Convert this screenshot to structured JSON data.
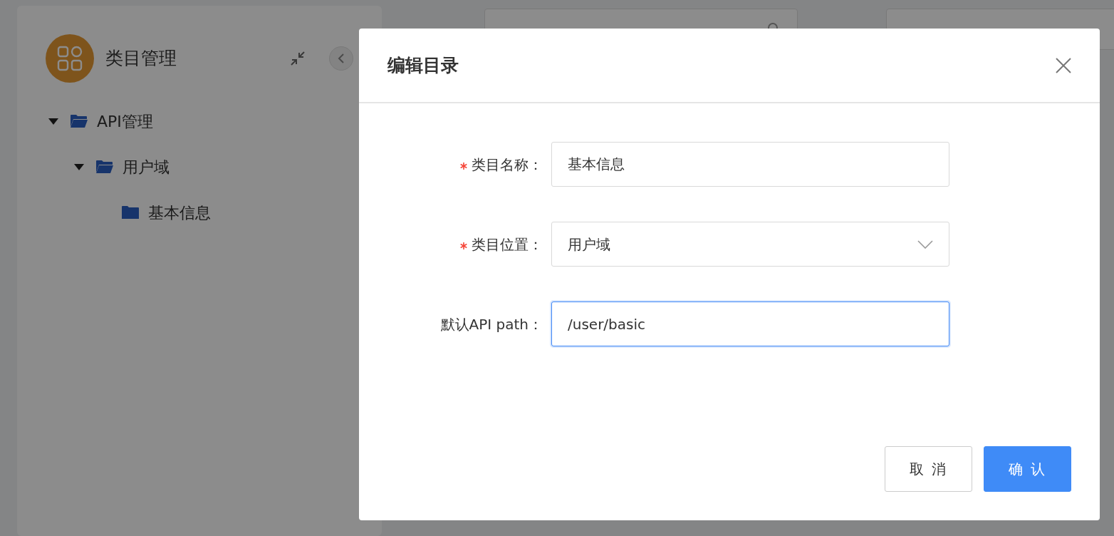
{
  "background": {
    "sidebar": {
      "title": "类目管理",
      "tree": [
        {
          "label": "API管理",
          "expanded": true,
          "children": [
            {
              "label": "用户域",
              "expanded": true,
              "children": [
                {
                  "label": "基本信息"
                }
              ]
            }
          ]
        }
      ]
    }
  },
  "dialog": {
    "title": "编辑目录",
    "fields": [
      {
        "kind": "text",
        "label": "类目名称：",
        "required": true,
        "value": "基本信息",
        "focused": false
      },
      {
        "kind": "select",
        "label": "类目位置：",
        "required": true,
        "value": "用户域",
        "focused": false
      },
      {
        "kind": "text",
        "label": "默认API path：",
        "required": false,
        "value": "/user/basic",
        "focused": true
      }
    ],
    "buttons": [
      {
        "label": "取 消",
        "primary": false
      },
      {
        "label": "确 认",
        "primary": true
      }
    ]
  }
}
